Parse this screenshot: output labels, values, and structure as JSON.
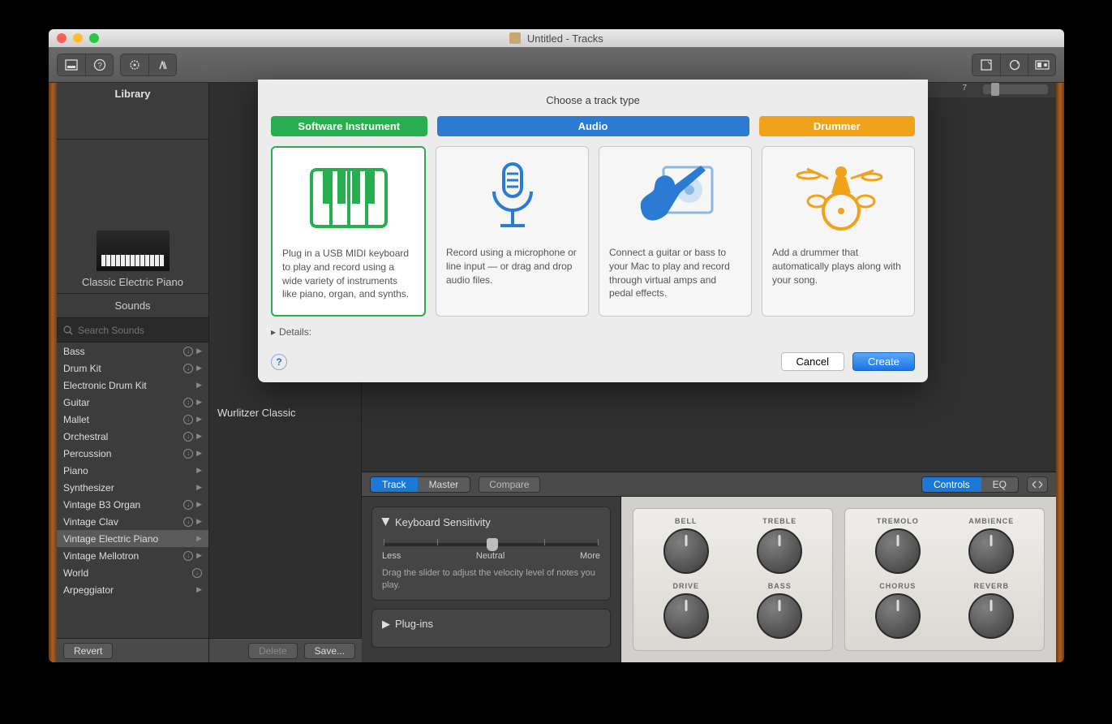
{
  "window": {
    "title": "Untitled - Tracks"
  },
  "toolbar": {
    "left_icons": [
      "library-icon",
      "help-icon",
      "smart-controls-icon",
      "scissors-icon"
    ],
    "right_icons": [
      "notepad-icon",
      "loop-icon",
      "media-icon"
    ]
  },
  "library": {
    "header": "Library",
    "instrument_name": "Classic Electric Piano",
    "sounds_label": "Sounds",
    "search_placeholder": "Search Sounds",
    "categories": [
      {
        "name": "Bass",
        "download": true,
        "arrow": true
      },
      {
        "name": "Drum Kit",
        "download": true,
        "arrow": true
      },
      {
        "name": "Electronic Drum Kit",
        "download": false,
        "arrow": true
      },
      {
        "name": "Guitar",
        "download": true,
        "arrow": true
      },
      {
        "name": "Mallet",
        "download": true,
        "arrow": true
      },
      {
        "name": "Orchestral",
        "download": true,
        "arrow": true
      },
      {
        "name": "Percussion",
        "download": true,
        "arrow": true
      },
      {
        "name": "Piano",
        "download": false,
        "arrow": true
      },
      {
        "name": "Synthesizer",
        "download": false,
        "arrow": true
      },
      {
        "name": "Vintage B3 Organ",
        "download": true,
        "arrow": true
      },
      {
        "name": "Vintage Clav",
        "download": true,
        "arrow": true
      },
      {
        "name": "Vintage Electric Piano",
        "download": false,
        "arrow": true,
        "selected": true
      },
      {
        "name": "Vintage Mellotron",
        "download": true,
        "arrow": true
      },
      {
        "name": "World",
        "download": true,
        "arrow": false
      },
      {
        "name": "Arpeggiator",
        "download": false,
        "arrow": true
      }
    ],
    "sub_item": "Wurlitzer Classic",
    "revert": "Revert",
    "delete": "Delete",
    "save": "Save..."
  },
  "ruler": {
    "mark": "7"
  },
  "inspector": {
    "tabs": {
      "track": "Track",
      "master": "Master"
    },
    "compare": "Compare",
    "view_tabs": {
      "controls": "Controls",
      "eq": "EQ"
    },
    "sensitivity": {
      "title": "Keyboard Sensitivity",
      "less": "Less",
      "neutral": "Neutral",
      "more": "More",
      "help": "Drag the slider to adjust the velocity level of notes you play."
    },
    "plugins": "Plug-ins",
    "knobs_left": [
      "BELL",
      "TREBLE",
      "DRIVE",
      "BASS"
    ],
    "knobs_right": [
      "TREMOLO",
      "AMBIENCE",
      "CHORUS",
      "REVERB"
    ]
  },
  "modal": {
    "title": "Choose a track type",
    "tabs": {
      "si": "Software Instrument",
      "audio": "Audio",
      "drummer": "Drummer"
    },
    "cards": {
      "si": "Plug in a USB MIDI keyboard to play and record using a wide variety of instruments like piano, organ, and synths.",
      "mic": "Record using a microphone or line input — or drag and drop audio files.",
      "guitar": "Connect a guitar or bass to your Mac to play and record through virtual amps and pedal effects.",
      "drummer": "Add a drummer that automatically plays along with your song."
    },
    "details": "Details:",
    "cancel": "Cancel",
    "create": "Create"
  }
}
